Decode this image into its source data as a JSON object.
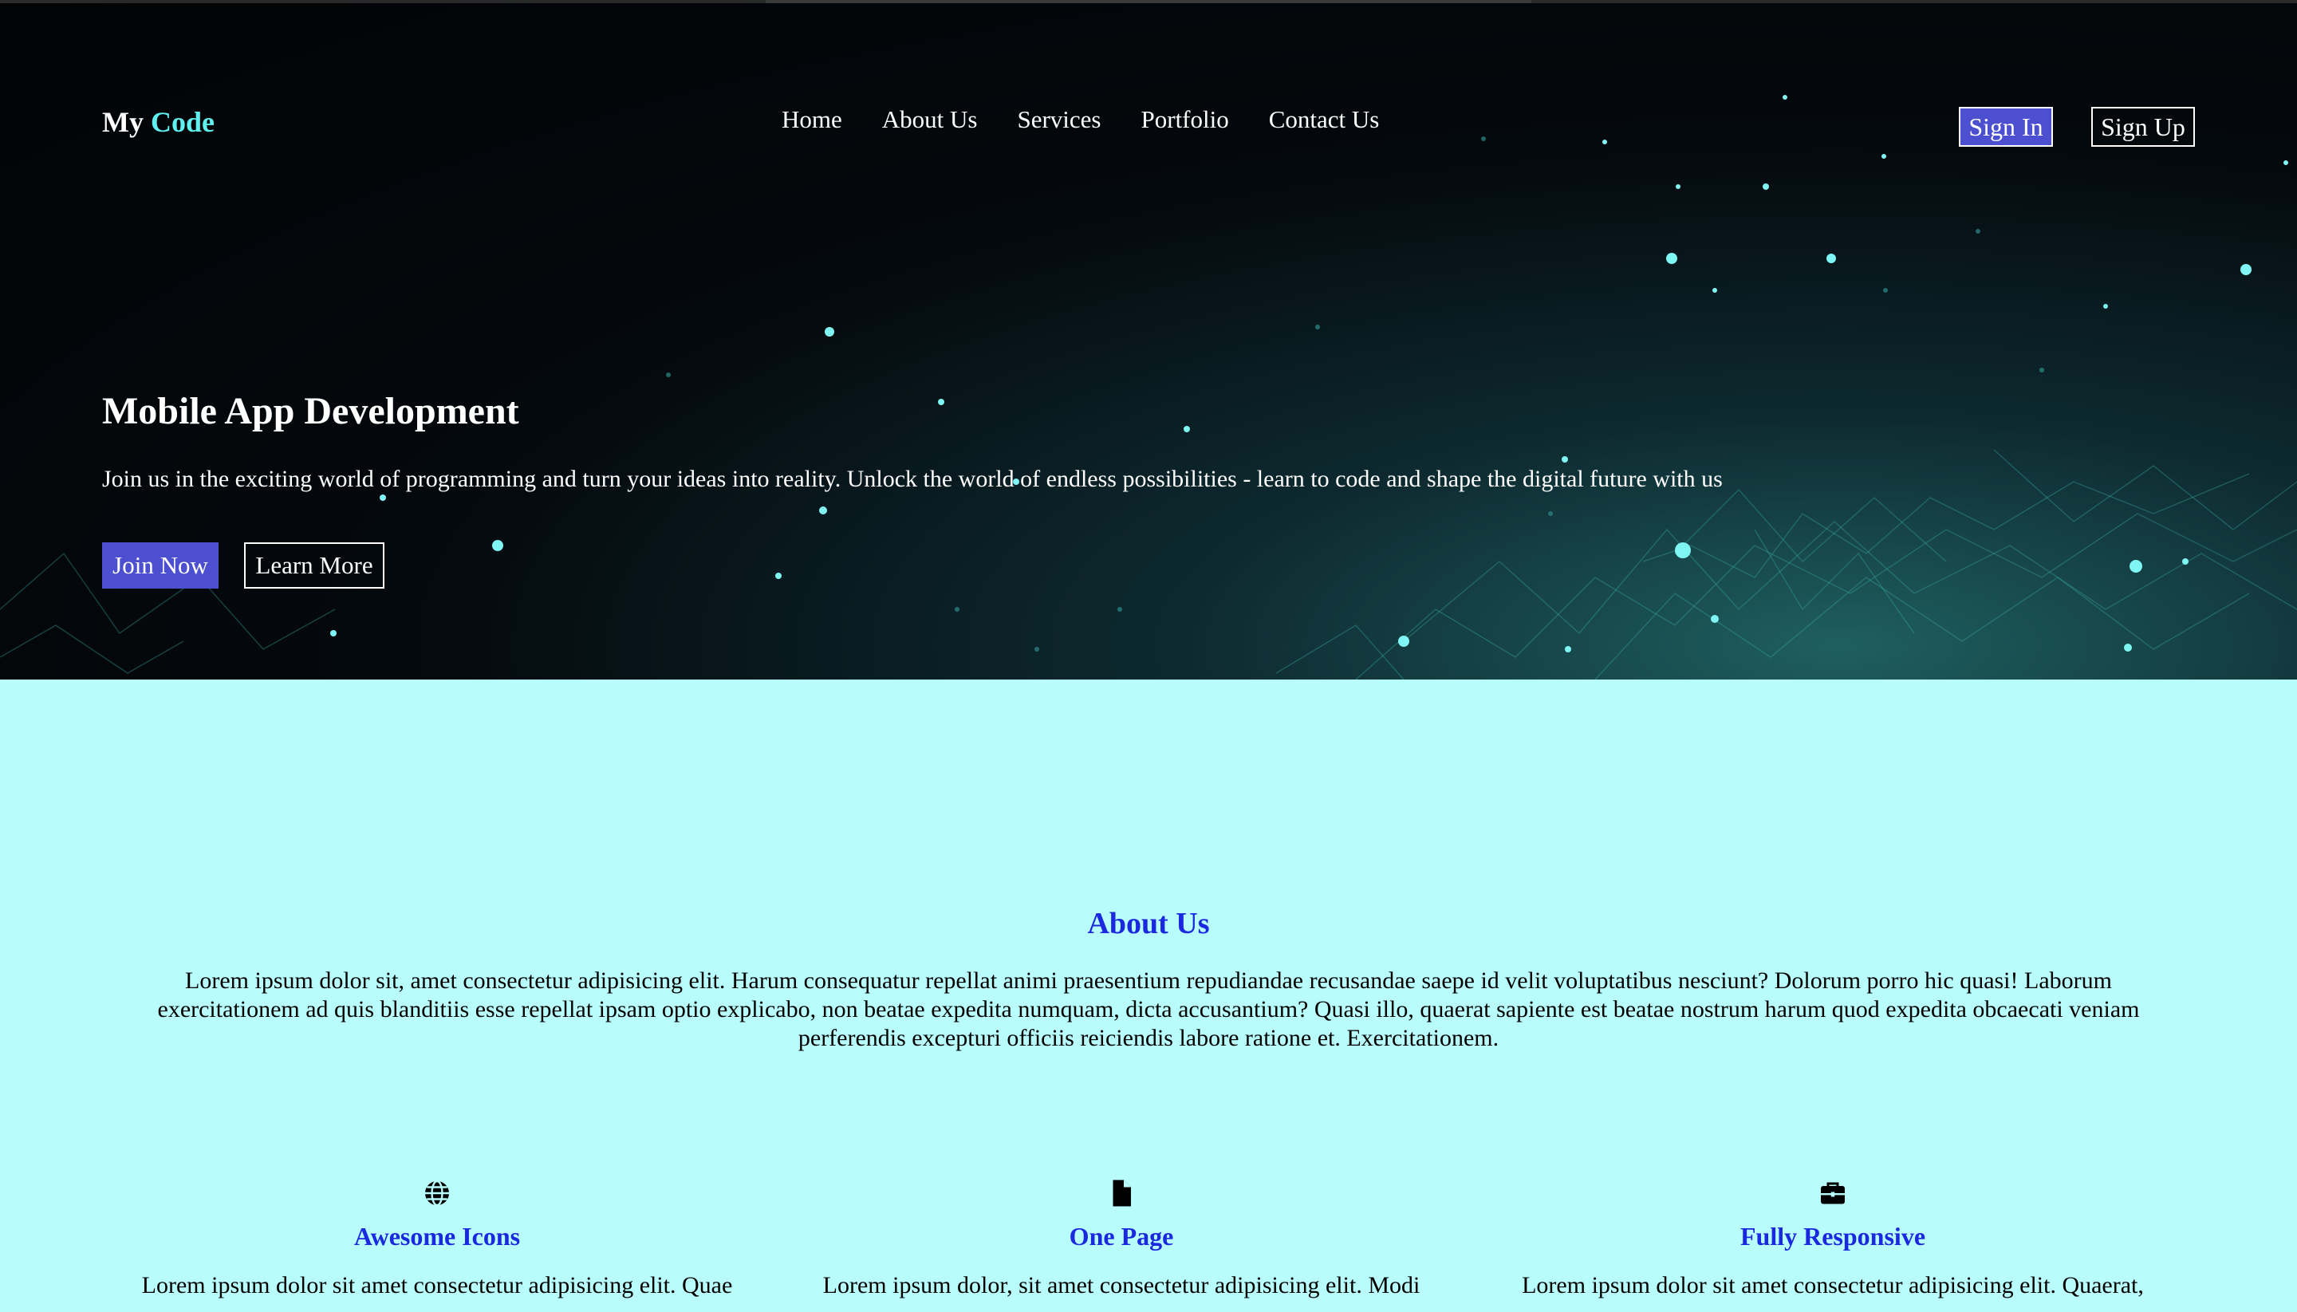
{
  "brand": {
    "name_first": "My",
    "name_accent": "Code"
  },
  "nav": {
    "items": [
      {
        "label": "Home"
      },
      {
        "label": "About Us"
      },
      {
        "label": "Services"
      },
      {
        "label": "Portfolio"
      },
      {
        "label": "Contact Us"
      }
    ]
  },
  "auth": {
    "sign_in": "Sign In",
    "sign_up": "Sign Up"
  },
  "hero": {
    "title": "Mobile App Development",
    "text": "Join us in the exciting world of programming and turn your ideas into reality. Unlock the world of endless possibilities - learn to code and shape the digital future with us",
    "join_label": "Join Now",
    "learn_label": "Learn More"
  },
  "about": {
    "title": "About Us",
    "text": "Lorem ipsum dolor sit, amet consectetur adipisicing elit. Harum consequatur repellat animi praesentium repudiandae recusandae saepe id velit voluptatibus nesciunt? Dolorum porro hic quasi! Laborum exercitationem ad quis blanditiis esse repellat ipsam optio explicabo, non beatae expedita numquam, dicta accusantium? Quasi illo, quaerat sapiente est beatae nostrum harum quod expedita obcaecati veniam perferendis excepturi officiis reiciendis labore ratione et. Exercitationem."
  },
  "features": [
    {
      "icon": "globe-icon",
      "title": "Awesome Icons",
      "text": "Lorem ipsum dolor sit amet consectetur adipisicing elit. Quae"
    },
    {
      "icon": "file-icon",
      "title": "One Page",
      "text": "Lorem ipsum dolor, sit amet consectetur adipisicing elit. Modi"
    },
    {
      "icon": "toolbox-icon",
      "title": "Fully Responsive",
      "text": "Lorem ipsum dolor sit amet consectetur adipisicing elit. Quaerat,"
    }
  ],
  "colors": {
    "accent_cyan": "#5ff0f0",
    "button_blue": "#4b4fd0",
    "heading_blue": "#1a28e0",
    "section_bg": "#b8fcfc"
  }
}
